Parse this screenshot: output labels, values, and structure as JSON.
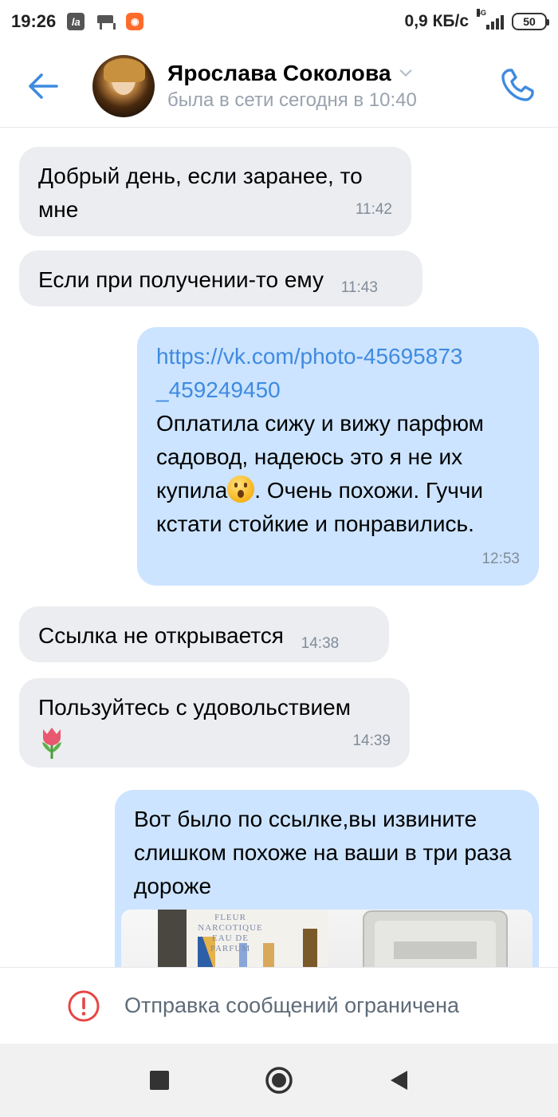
{
  "status_bar": {
    "time": "19:26",
    "ia_icon": "la",
    "network_speed": "0,9 КБ/с",
    "network_type": "4G",
    "battery": "50"
  },
  "header": {
    "contact_name": "Ярослава Соколова",
    "contact_status": "была в сети сегодня в 10:40"
  },
  "messages": [
    {
      "direction": "in",
      "text": "Добрый день, если заранее, то мне",
      "time": "11:42"
    },
    {
      "direction": "in",
      "text": "Если при получении-то ему",
      "time": "11:43"
    },
    {
      "direction": "out",
      "link_line1": "https://vk.com/photo-45695873",
      "link_line2": "_459249450",
      "text_before_emoji": "Оплатила сижу и вижу парфюм садовод, надеюсь это я не их купила",
      "text_after_emoji": ". Очень похожи. Гуччи кстати стойкие и понравились.",
      "time": "12:53"
    },
    {
      "direction": "in",
      "text": "Ссылка не открывается",
      "time": "14:38"
    },
    {
      "direction": "in",
      "text": "Пользуйтесь с удовольствием",
      "time": "14:39"
    },
    {
      "direction": "out",
      "text": "Вот было по ссылке,вы извините слишком похоже на ваши в три раза дороже",
      "photo_label": "FLEUR NARCOTIQUE EAU DE PARFUM"
    }
  ],
  "restricted_bar": {
    "text": "Отправка сообщений ограничена"
  },
  "colors": {
    "accent": "#3f8ae0",
    "incoming_bubble": "#ebedf0",
    "outgoing_bubble": "#cce4ff",
    "warning": "#e64646"
  }
}
